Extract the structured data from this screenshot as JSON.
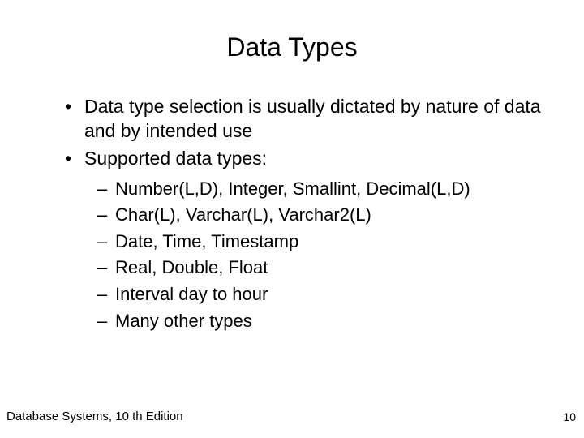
{
  "title": "Data Types",
  "bullets": [
    "Data type selection is usually dictated by nature of data and by intended use",
    "Supported data types:"
  ],
  "sub_bullets": [
    "Number(L,D), Integer, Smallint, Decimal(L,D)",
    "Char(L), Varchar(L), Varchar2(L)",
    "Date, Time, Timestamp",
    "Real, Double, Float",
    "Interval day to hour",
    "Many other types"
  ],
  "footer_left": "Database Systems, 10 th Edition",
  "footer_right": "10"
}
